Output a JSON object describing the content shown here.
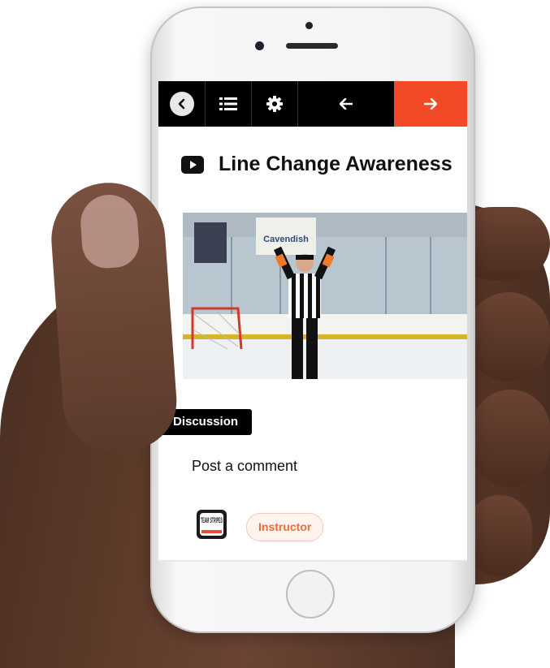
{
  "toolbar": {
    "back_icon": "chevron-left-icon",
    "list_icon": "list-icon",
    "settings_icon": "gear-icon",
    "prev_icon": "arrow-left-icon",
    "next_icon": "arrow-right-icon",
    "accent_color": "#f24a26"
  },
  "lesson": {
    "type_icon": "video-play-icon",
    "title": "Line Change Awareness"
  },
  "video": {
    "banner_text": "Cavendish"
  },
  "discussion": {
    "tab_label": "Discussion",
    "post_label": "Post a comment",
    "author_logo_text": "TEAM STRIPES",
    "role_badge": "Instructor"
  }
}
